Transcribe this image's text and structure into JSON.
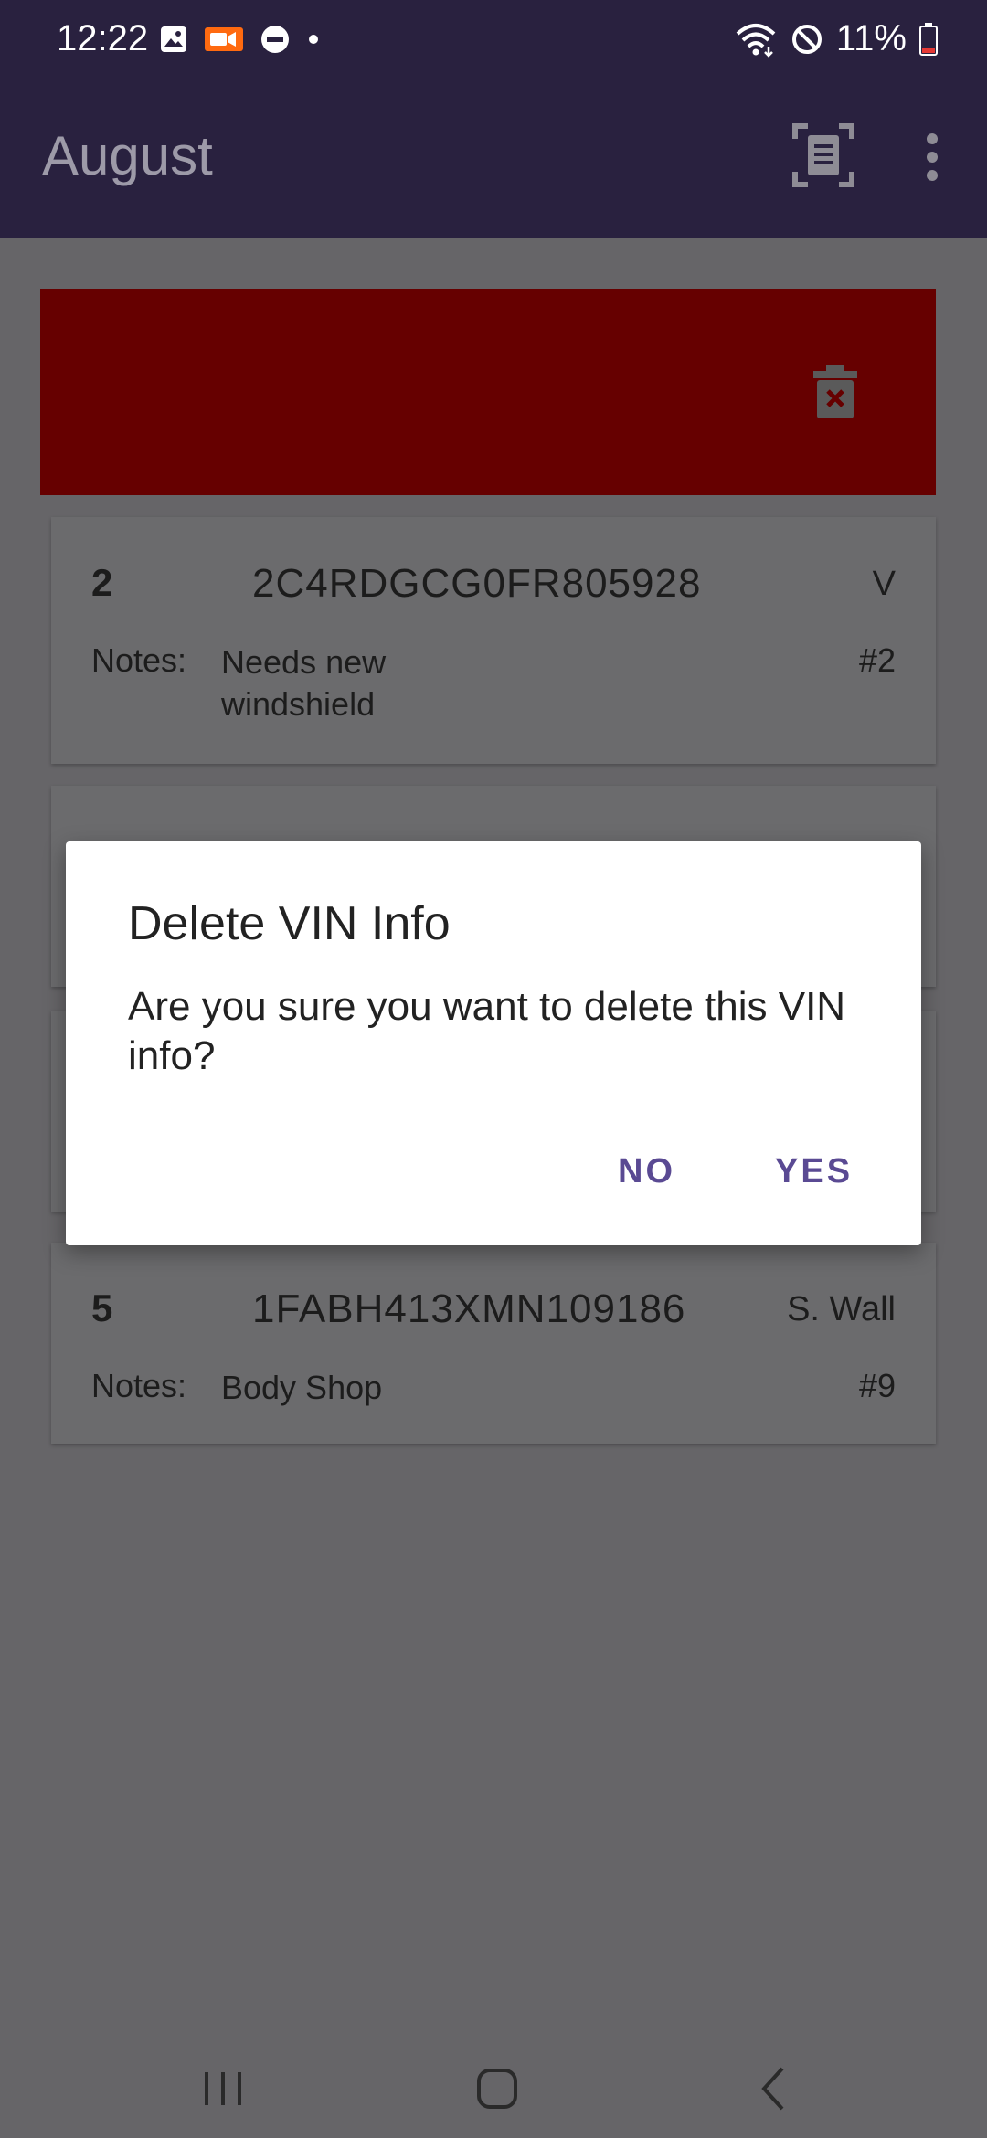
{
  "status_bar": {
    "time": "12:22",
    "battery": "11%"
  },
  "app_bar": {
    "title": "August"
  },
  "cards": [
    {
      "number": "2",
      "vin": "2C4RDGCG0FR805928",
      "assignee": "V",
      "notes_label": "Notes:",
      "notes": "Needs new windshield",
      "tag": "#2"
    },
    {
      "number": "5",
      "vin": "1FABH413XMN109186",
      "assignee": "S. Wall",
      "notes_label": "Notes:",
      "notes": "Body Shop",
      "tag": "#9"
    }
  ],
  "dialog": {
    "title": "Delete VIN Info",
    "message": "Are you sure you want to delete this VIN info?",
    "no_label": "NO",
    "yes_label": "YES"
  },
  "colors": {
    "app_bar": "#29213f",
    "delete_background": "#660000",
    "dialog_accent": "#5a4a93",
    "scrim": "#666568"
  }
}
